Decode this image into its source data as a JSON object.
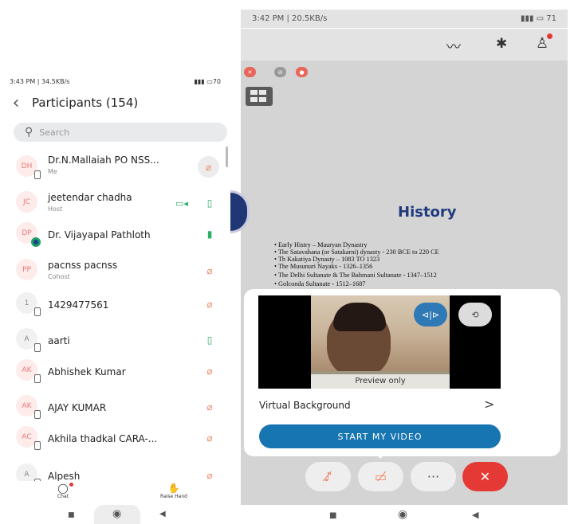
{
  "left": {
    "status": {
      "time": "3:43 PM | 34.5KB/s",
      "right": "70"
    },
    "header": {
      "back_glyph": "‹",
      "title": "Participants (154)"
    },
    "search": {
      "placeholder": "Search"
    },
    "participants": [
      {
        "initials": "DH",
        "name": "Dr.N.Mallaiah PO NSS...",
        "role": "Me",
        "mic": "off",
        "mic_bg": true
      },
      {
        "initials": "JC",
        "name": "jeetendar chadha",
        "role": "Host",
        "mic": "on",
        "video": true
      },
      {
        "initials": "DP",
        "name": "Dr. Vijayapal Pathloth",
        "role": "",
        "mic": "on-talk"
      },
      {
        "initials": "PP",
        "name": "pacnss pacnss",
        "role": "Cohost",
        "mic": "off"
      },
      {
        "initials": "1",
        "name": "1429477561",
        "role": "",
        "mic": "off"
      },
      {
        "initials": "A",
        "name": "aarti",
        "role": "",
        "mic": "on"
      },
      {
        "initials": "AK",
        "name": "Abhishek Kumar",
        "role": "",
        "mic": "off"
      },
      {
        "initials": "AK",
        "name": "AJAY KUMAR",
        "role": "",
        "mic": "off"
      },
      {
        "initials": "AC",
        "name": "Akhila thadkal CARA-...",
        "role": "",
        "mic": "off"
      },
      {
        "initials": "A",
        "name": "Alpesh",
        "role": "",
        "mic": "off"
      }
    ],
    "bottom": {
      "chat_label": "Chat",
      "raise_label": "Raise Hand"
    }
  },
  "right": {
    "status": {
      "time": "3:42 PM | 20.5KB/s",
      "battery": "71"
    },
    "slide": {
      "title": "History",
      "bullets": [
        "Early Histry – Mauryan Dynastry",
        "The Satavahana (or Satakarni) dynasty  - 230 BCE to 220 CE",
        "Th Kakatiya Dynasty – 1083 TO 1323",
        "The Musunuri Nayaks - 1326–1356",
        "The Delhi Sultanate & The Bahmani Sultanate - 1347–1512",
        "Golconda Sultanate - 1512–1687"
      ]
    },
    "popup": {
      "preview_label": "Preview only",
      "virtual_background": "Virtual Background",
      "arrow": ">",
      "start_button": "START MY VIDEO"
    },
    "controls": {
      "more": "···"
    }
  },
  "colors": {
    "accent": "#1776b1",
    "end": "#e53935",
    "mic_off": "#ee8866",
    "mic_on": "#2cae65"
  }
}
